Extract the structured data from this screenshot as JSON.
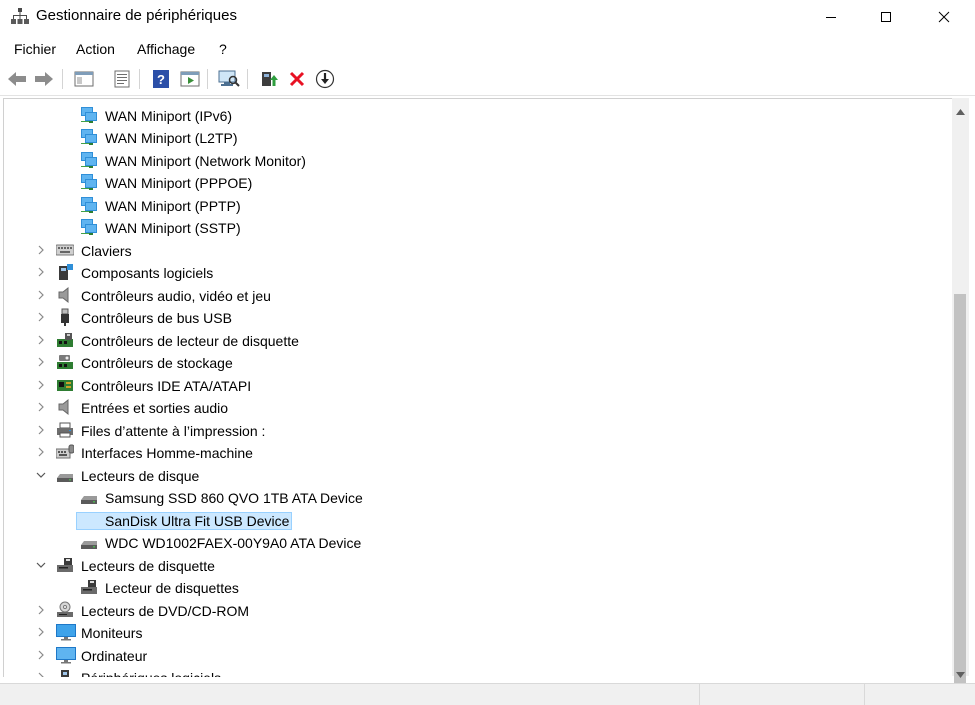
{
  "window": {
    "title": "Gestionnaire de périphériques"
  },
  "menu": [
    {
      "label": "Fichier"
    },
    {
      "label": "Action"
    },
    {
      "label": "Affichage"
    },
    {
      "label": "?"
    }
  ],
  "toolbar": {
    "buttons": [
      {
        "icon": "back-arrow-icon"
      },
      {
        "icon": "forward-arrow-icon"
      },
      {
        "icon": "show-hide-console-tree-icon"
      },
      {
        "icon": "properties-icon"
      },
      {
        "icon": "help-icon"
      },
      {
        "icon": "action-pane-icon"
      },
      {
        "icon": "scan-hardware-icon"
      },
      {
        "icon": "update-driver-icon"
      },
      {
        "icon": "uninstall-device-icon"
      },
      {
        "icon": "disable-device-icon"
      }
    ]
  },
  "tree": {
    "items": [
      {
        "label": "WAN Miniport (IPv6)",
        "level": 2,
        "icon": "network-adapter-icon"
      },
      {
        "label": "WAN Miniport (L2TP)",
        "level": 2,
        "icon": "network-adapter-icon"
      },
      {
        "label": "WAN Miniport (Network Monitor)",
        "level": 2,
        "icon": "network-adapter-icon"
      },
      {
        "label": "WAN Miniport (PPPOE)",
        "level": 2,
        "icon": "network-adapter-icon"
      },
      {
        "label": "WAN Miniport (PPTP)",
        "level": 2,
        "icon": "network-adapter-icon"
      },
      {
        "label": "WAN Miniport (SSTP)",
        "level": 2,
        "icon": "network-adapter-icon"
      },
      {
        "label": "Claviers",
        "level": 1,
        "expanded": false,
        "icon": "keyboard-icon"
      },
      {
        "label": "Composants logiciels",
        "level": 1,
        "expanded": false,
        "icon": "software-component-icon"
      },
      {
        "label": "Contrôleurs audio, vidéo et jeu",
        "level": 1,
        "expanded": false,
        "icon": "speaker-icon"
      },
      {
        "label": "Contrôleurs de bus USB",
        "level": 1,
        "expanded": false,
        "icon": "usb-icon"
      },
      {
        "label": "Contrôleurs de lecteur de disquette",
        "level": 1,
        "expanded": false,
        "icon": "floppy-controller-icon"
      },
      {
        "label": "Contrôleurs de stockage",
        "level": 1,
        "expanded": false,
        "icon": "storage-controller-icon"
      },
      {
        "label": "Contrôleurs IDE ATA/ATAPI",
        "level": 1,
        "expanded": false,
        "icon": "ide-controller-icon"
      },
      {
        "label": "Entrées et sorties audio",
        "level": 1,
        "expanded": false,
        "icon": "speaker-icon"
      },
      {
        "label": "Files d’attente à l’impression :",
        "level": 1,
        "expanded": false,
        "icon": "printer-icon"
      },
      {
        "label": "Interfaces Homme-machine",
        "level": 1,
        "expanded": false,
        "icon": "hid-icon"
      },
      {
        "label": "Lecteurs de disque",
        "level": 1,
        "expanded": true,
        "icon": "disk-drive-icon"
      },
      {
        "label": "Samsung SSD 860 QVO 1TB ATA Device",
        "level": 2,
        "icon": "disk-drive-icon"
      },
      {
        "label": "SanDisk Ultra Fit USB Device",
        "level": 2,
        "icon": "disk-drive-icon",
        "selected": true
      },
      {
        "label": "WDC WD1002FAEX-00Y9A0 ATA Device",
        "level": 2,
        "icon": "disk-drive-icon"
      },
      {
        "label": "Lecteurs de disquette",
        "level": 1,
        "expanded": true,
        "icon": "floppy-drive-icon"
      },
      {
        "label": "Lecteur de disquettes",
        "level": 2,
        "icon": "floppy-drive-icon"
      },
      {
        "label": "Lecteurs de DVD/CD-ROM",
        "level": 1,
        "expanded": false,
        "icon": "dvd-drive-icon"
      },
      {
        "label": "Moniteurs",
        "level": 1,
        "expanded": false,
        "icon": "monitor-icon"
      },
      {
        "label": "Ordinateur",
        "level": 1,
        "expanded": false,
        "icon": "computer-icon"
      },
      {
        "label": "Périphériques logiciels",
        "level": 1,
        "expanded": false,
        "icon": "software-device-icon"
      }
    ]
  },
  "colors": {
    "selection_bg": "#cce8ff",
    "selection_border": "#99d1ff",
    "delete_red": "#e81123"
  }
}
